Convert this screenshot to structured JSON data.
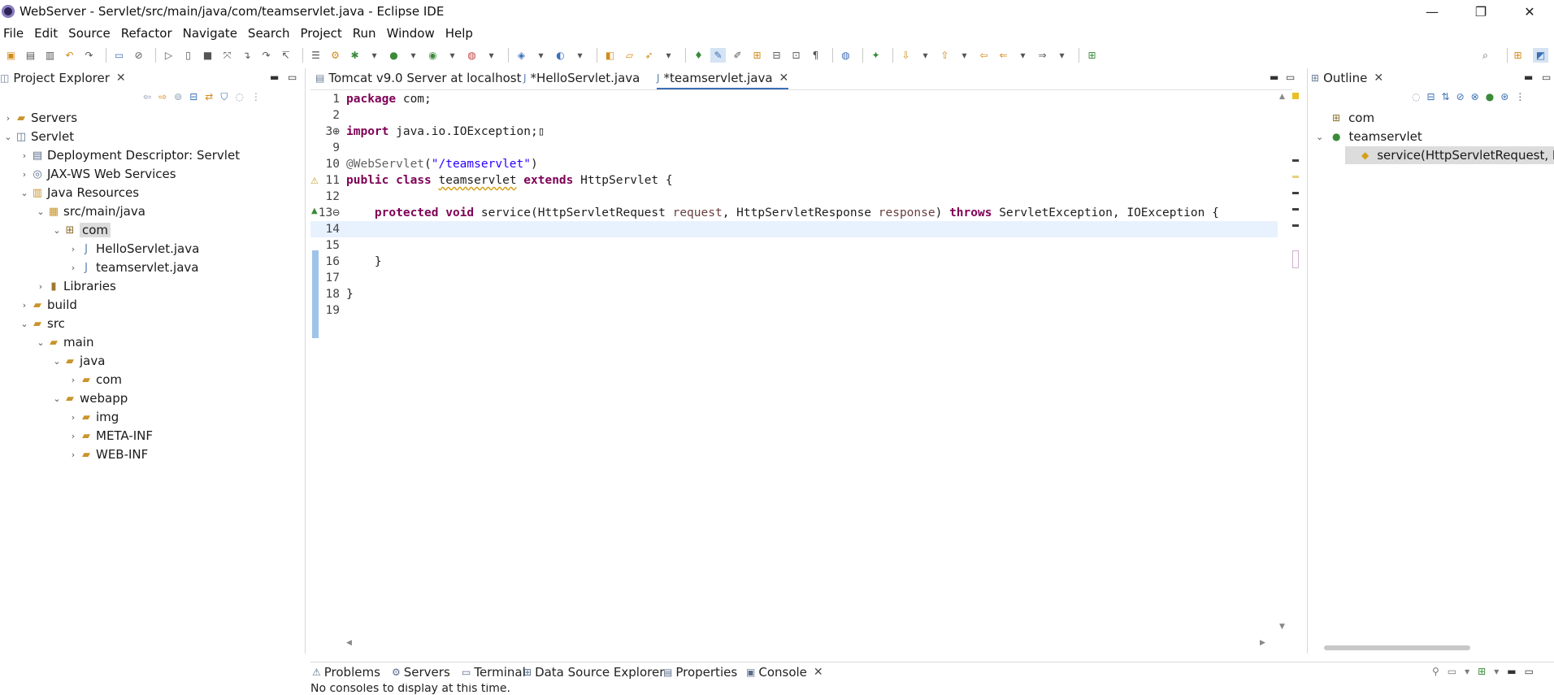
{
  "window": {
    "title": "WebServer - Servlet/src/main/java/com/teamservlet.java - Eclipse IDE",
    "minimize_glyph": "—",
    "restore_glyph": "❐",
    "close_glyph": "✕"
  },
  "menu": [
    "File",
    "Edit",
    "Source",
    "Refactor",
    "Navigate",
    "Search",
    "Project",
    "Run",
    "Window",
    "Help"
  ],
  "project_explorer": {
    "title": "Project Explorer",
    "tree": [
      {
        "label": "Servers",
        "icon": "folder-icon",
        "chev": "›",
        "indent": 0
      },
      {
        "label": "Servlet",
        "icon": "project-icon",
        "chev": "⌄",
        "indent": 0
      },
      {
        "label": "Deployment Descriptor: Servlet",
        "icon": "descriptor-icon",
        "chev": "›",
        "indent": 1
      },
      {
        "label": "JAX-WS Web Services",
        "icon": "webservice-icon",
        "chev": "›",
        "indent": 1
      },
      {
        "label": "Java Resources",
        "icon": "java-resources-icon",
        "chev": "⌄",
        "indent": 1
      },
      {
        "label": "src/main/java",
        "icon": "source-folder-icon",
        "chev": "⌄",
        "indent": 2
      },
      {
        "label": "com",
        "icon": "package-icon",
        "chev": "⌄",
        "indent": 3,
        "selected": true
      },
      {
        "label": "HelloServlet.java",
        "icon": "java-file-icon",
        "chev": "›",
        "indent": 4
      },
      {
        "label": "teamservlet.java",
        "icon": "java-file-icon",
        "chev": "›",
        "indent": 4
      },
      {
        "label": "Libraries",
        "icon": "library-icon",
        "chev": "›",
        "indent": 2
      },
      {
        "label": "build",
        "icon": "folder-icon",
        "chev": "›",
        "indent": 1
      },
      {
        "label": "src",
        "icon": "folder-icon",
        "chev": "⌄",
        "indent": 1
      },
      {
        "label": "main",
        "icon": "folder-icon",
        "chev": "⌄",
        "indent": 2
      },
      {
        "label": "java",
        "icon": "folder-icon",
        "chev": "⌄",
        "indent": 3
      },
      {
        "label": "com",
        "icon": "folder-icon",
        "chev": "›",
        "indent": 4
      },
      {
        "label": "webapp",
        "icon": "folder-icon",
        "chev": "⌄",
        "indent": 3
      },
      {
        "label": "img",
        "icon": "folder-icon",
        "chev": "›",
        "indent": 4
      },
      {
        "label": "META-INF",
        "icon": "folder-icon",
        "chev": "›",
        "indent": 4
      },
      {
        "label": "WEB-INF",
        "icon": "folder-icon",
        "chev": "›",
        "indent": 4
      }
    ]
  },
  "editor": {
    "tabs": [
      {
        "label": "Tomcat v9.0 Server at localhost",
        "active": false
      },
      {
        "label": "*HelloServlet.java",
        "active": false
      },
      {
        "label": "*teamservlet.java",
        "active": true
      }
    ],
    "lines": [
      {
        "n": "1",
        "html": "<span class='kw'>package</span> com;"
      },
      {
        "n": "2",
        "html": ""
      },
      {
        "n": "3⊕",
        "html": "<span class='kw'>import</span> java.io.IOException;▯"
      },
      {
        "n": "9",
        "html": ""
      },
      {
        "n": "10",
        "html": "<span class='ann'>@WebServlet</span>(<span class='str'>\"/teamservlet\"</span>)"
      },
      {
        "n": "11",
        "html": "<span class='kw'>public</span> <span class='kw'>class</span> <span class='cls-u'>teamservlet</span> <span class='kw'>extends</span> HttpServlet {"
      },
      {
        "n": "12",
        "html": ""
      },
      {
        "n": "13⊖",
        "html": "    <span class='kw'>protected</span> <span class='kw'>void</span> service(HttpServletRequest <span class='param'>request</span>, HttpServletResponse <span class='param'>response</span>) <span class='kw'>throws</span> ServletException, IOException {"
      },
      {
        "n": "14",
        "html": "",
        "current": true
      },
      {
        "n": "15",
        "html": ""
      },
      {
        "n": "16",
        "html": "    }"
      },
      {
        "n": "17",
        "html": ""
      },
      {
        "n": "18",
        "html": "}"
      },
      {
        "n": "19",
        "html": ""
      }
    ]
  },
  "outline": {
    "title": "Outline",
    "items": [
      {
        "label": "com",
        "icon": "package-decl-icon",
        "chev": "",
        "indent": 0
      },
      {
        "label": "teamservlet",
        "icon": "class-icon",
        "chev": "⌄",
        "indent": 0
      },
      {
        "label": "service(HttpServletRequest, HttpSe",
        "icon": "method-protected-icon",
        "chev": "",
        "indent": 1,
        "selected": true
      }
    ]
  },
  "bottom": {
    "tabs": [
      {
        "label": "Problems",
        "icon": "problems-icon"
      },
      {
        "label": "Servers",
        "icon": "servers-icon"
      },
      {
        "label": "Terminal",
        "icon": "terminal-icon"
      },
      {
        "label": "Data Source Explorer",
        "icon": "datasource-icon"
      },
      {
        "label": "Properties",
        "icon": "properties-icon"
      },
      {
        "label": "Console",
        "icon": "console-icon",
        "active": true
      }
    ],
    "message": "No consoles to display at this time."
  }
}
